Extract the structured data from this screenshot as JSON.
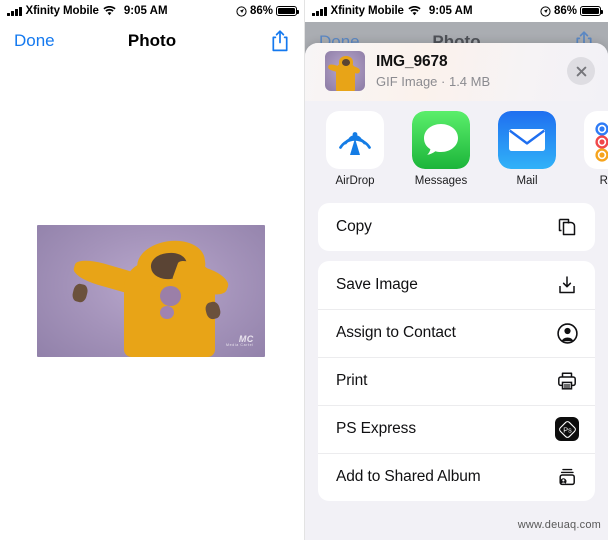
{
  "status_bar": {
    "carrier": "Xfinity Mobile",
    "time": "9:05 AM",
    "battery_percent": "86%",
    "signal_icon": "cellular-bars-icon",
    "wifi_icon": "wifi-icon",
    "location_icon": "location-services-icon",
    "battery_icon": "battery-icon"
  },
  "nav_bar": {
    "done_label": "Done",
    "title": "Photo",
    "share_icon": "share-icon"
  },
  "photo": {
    "alt": "person in yellow hoodie on lavender background",
    "watermark": "MC",
    "watermark_sub": "Media Cartel"
  },
  "share_sheet": {
    "file_name": "IMG_9678",
    "file_meta": "GIF Image · 1.4 MB",
    "close_icon": "close-icon",
    "thumbnail_name": "file-thumbnail",
    "apps": [
      {
        "label": "AirDrop",
        "icon": "airdrop-icon"
      },
      {
        "label": "Messages",
        "icon": "messages-icon"
      },
      {
        "label": "Mail",
        "icon": "mail-icon"
      },
      {
        "label": "Remi",
        "icon": "reminders-icon"
      }
    ],
    "groups": [
      {
        "rows": [
          {
            "label": "Copy",
            "icon": "copy-icon"
          }
        ]
      },
      {
        "rows": [
          {
            "label": "Save Image",
            "icon": "save-image-icon"
          },
          {
            "label": "Assign to Contact",
            "icon": "contact-icon"
          },
          {
            "label": "Print",
            "icon": "print-icon"
          },
          {
            "label": "PS Express",
            "icon": "photoshop-express-icon"
          },
          {
            "label": "Add to Shared Album",
            "icon": "shared-album-icon"
          }
        ]
      }
    ]
  },
  "watermark": "www.deuaq.com",
  "colors": {
    "accent_blue": "#1479ef",
    "messages_green": "#4cd465",
    "mail_blue": "#1e8cf5",
    "sheet_bg": "#f2f1f6",
    "card_bg": "#ffffff"
  }
}
